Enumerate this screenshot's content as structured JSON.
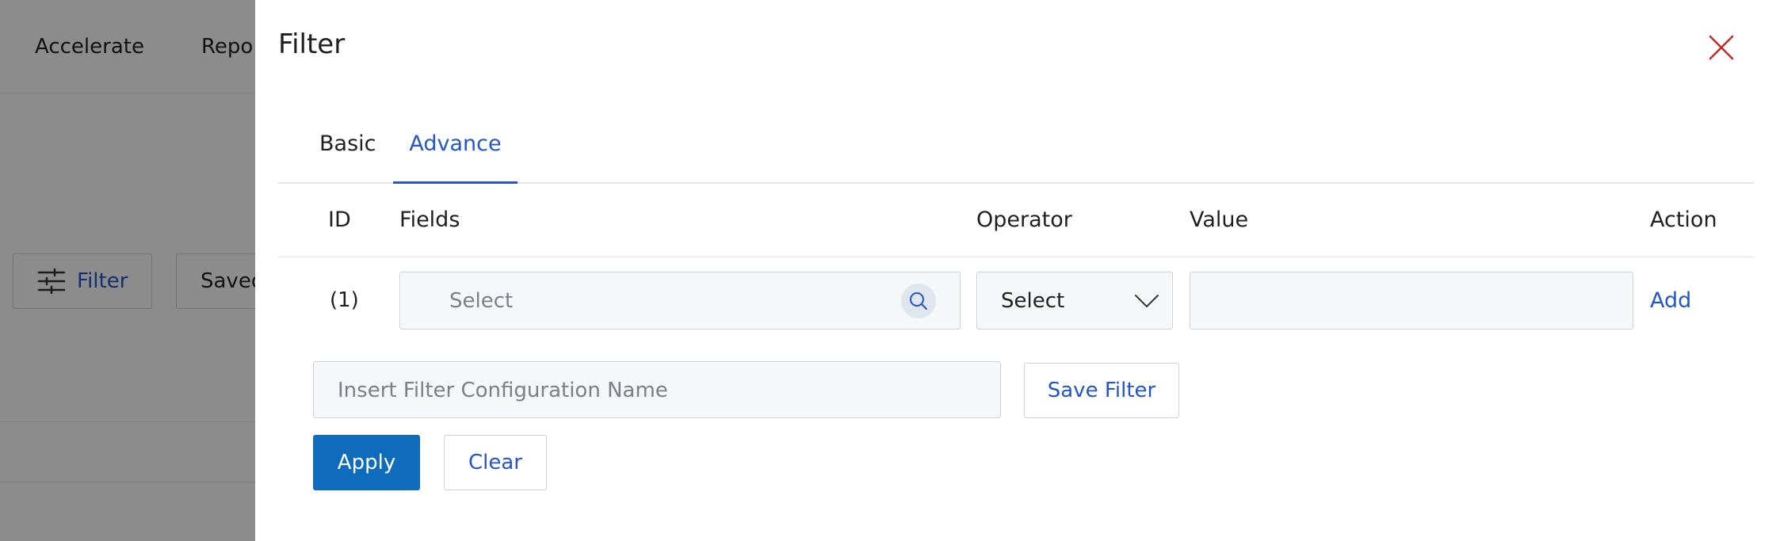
{
  "background": {
    "nav": [
      "Accelerate",
      "Repo"
    ],
    "filter_button": "Filter",
    "saved_button": "Saved"
  },
  "drawer": {
    "title": "Filter",
    "tabs": [
      {
        "label": "Basic",
        "active": false
      },
      {
        "label": "Advance",
        "active": true
      }
    ],
    "columns": {
      "id": "ID",
      "fields": "Fields",
      "operator": "Operator",
      "value": "Value",
      "action": "Action"
    },
    "row": {
      "id": "(1)",
      "field_placeholder": "Select",
      "operator_value": "Select",
      "value": "",
      "action_label": "Add"
    },
    "config_name_placeholder": "Insert Filter Configuration Name",
    "save_filter_label": "Save Filter",
    "apply_label": "Apply",
    "clear_label": "Clear"
  },
  "colors": {
    "accent": "#2256c9",
    "primary_button": "#0f6cbd",
    "close_icon": "#c62828",
    "overlay": "rgba(0,0,0,0.45)"
  },
  "icons": [
    "filter-sliders-icon",
    "close-icon",
    "search-icon",
    "chevron-down-icon"
  ]
}
